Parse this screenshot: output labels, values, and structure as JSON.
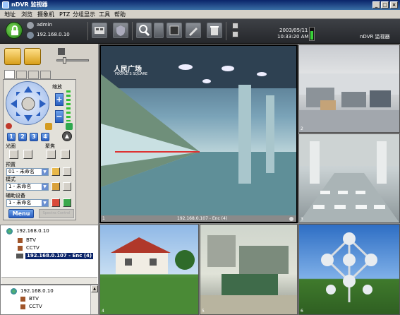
{
  "window": {
    "title": "nDVR 监视器",
    "minimize_label": "_",
    "maximize_label": "□",
    "close_label": "×"
  },
  "menu": {
    "items": [
      "地址",
      "浏览",
      "摄象机",
      "PTZ",
      "分组显示",
      "工具",
      "帮助"
    ]
  },
  "toolbar": {
    "user": "admin",
    "server": "192.168.0.10",
    "date": "2003/05/11",
    "time": "10:33:20 AM",
    "brand": "nDVR 监视器"
  },
  "ptz": {
    "zoom_label": "缩放",
    "preset_buttons": [
      "1",
      "2",
      "3",
      "4"
    ],
    "aperture_label": "光圈",
    "focus_label": "聚焦",
    "preset_label": "预置",
    "preset_value": "01 - 未命名",
    "pattern_label": "模式",
    "pattern_value": "1 - 未命名",
    "aux_label": "辅助设备",
    "aux_value": "1 - 未命名",
    "menu_button": "Menu",
    "disabled_button": "Spectra Control"
  },
  "tree1": {
    "server": "192.168.0.10",
    "groups": [
      "BTV",
      "CCTV"
    ],
    "selected": "192.168.0.107 - Enc (4)"
  },
  "tree2": {
    "server": "192.168.0.10",
    "groups": [
      "BTV",
      "CCTV"
    ]
  },
  "video": {
    "main_caption": "192.168.0.107 - Enc (4)",
    "main_index": "1",
    "main_sign": "人民广场",
    "main_sign_en": "PEOPLE'S SQUARE",
    "cells": [
      "2",
      "3",
      "4",
      "5",
      "6"
    ]
  }
}
